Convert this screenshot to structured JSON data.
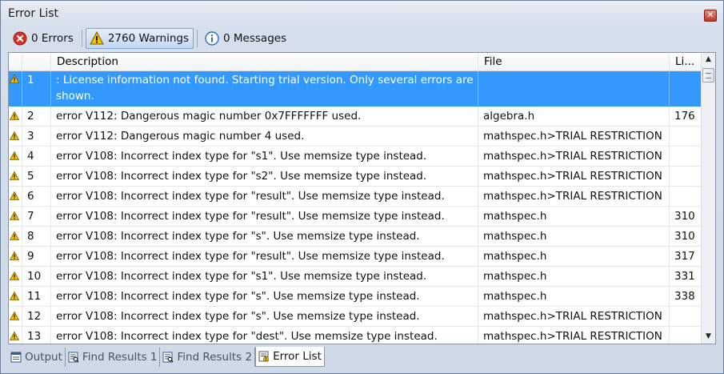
{
  "window": {
    "title": "Error List",
    "close_glyph": "✕"
  },
  "toolbar": {
    "errors_label": "0 Errors",
    "warnings_label": "2760 Warnings",
    "messages_label": "0 Messages"
  },
  "columns": {
    "icon": "",
    "number": "",
    "description": "Description",
    "file": "File",
    "line": "Li..."
  },
  "rows": [
    {
      "num": "1",
      "description": ": License information not found. Starting trial version. Only several errors are shown.",
      "file": "",
      "line": ""
    },
    {
      "num": "2",
      "description": "error V112: Dangerous magic number 0x7FFFFFFF used.",
      "file": "algebra.h",
      "line": "176"
    },
    {
      "num": "3",
      "description": "error V112: Dangerous magic number 4 used.",
      "file": "mathspec.h>TRIAL RESTRICTION",
      "line": ""
    },
    {
      "num": "4",
      "description": "error V108: Incorrect index type for \"s1\". Use memsize type instead.",
      "file": "mathspec.h>TRIAL RESTRICTION",
      "line": ""
    },
    {
      "num": "5",
      "description": "error V108: Incorrect index type for \"s2\". Use memsize type instead.",
      "file": "mathspec.h>TRIAL RESTRICTION",
      "line": ""
    },
    {
      "num": "6",
      "description": "error V108: Incorrect index type for \"result\". Use memsize type instead.",
      "file": "mathspec.h>TRIAL RESTRICTION",
      "line": ""
    },
    {
      "num": "7",
      "description": "error V108: Incorrect index type for \"result\". Use memsize type instead.",
      "file": "mathspec.h",
      "line": "310"
    },
    {
      "num": "8",
      "description": "error V108: Incorrect index type for \"s\". Use memsize type instead.",
      "file": "mathspec.h",
      "line": "310"
    },
    {
      "num": "9",
      "description": "error V108: Incorrect index type for \"result\". Use memsize type instead.",
      "file": "mathspec.h",
      "line": "317"
    },
    {
      "num": "10",
      "description": "error V108: Incorrect index type for \"s1\". Use memsize type instead.",
      "file": "mathspec.h",
      "line": "331"
    },
    {
      "num": "11",
      "description": "error V108: Incorrect index type for \"s\". Use memsize type instead.",
      "file": "mathspec.h",
      "line": "338"
    },
    {
      "num": "12",
      "description": "error V108: Incorrect index type for \"s\". Use memsize type instead.",
      "file": "mathspec.h>TRIAL RESTRICTION",
      "line": ""
    },
    {
      "num": "13",
      "description": "error V108: Incorrect index type for \"dest\". Use memsize type instead.",
      "file": "mathspec.h>TRIAL RESTRICTION",
      "line": ""
    }
  ],
  "bottom_tabs": [
    {
      "label": "Output",
      "icon": "output-icon"
    },
    {
      "label": "Find Results 1",
      "icon": "find-results-icon"
    },
    {
      "label": "Find Results 2",
      "icon": "find-results-icon"
    },
    {
      "label": "Error List",
      "icon": "error-list-icon"
    }
  ],
  "colors": {
    "selection": "#3399ff",
    "warning": "#f2c200",
    "error": "#d93025",
    "info": "#2b6cc4"
  },
  "scrollbar": {
    "up_glyph": "▲",
    "down_glyph": "▼"
  }
}
